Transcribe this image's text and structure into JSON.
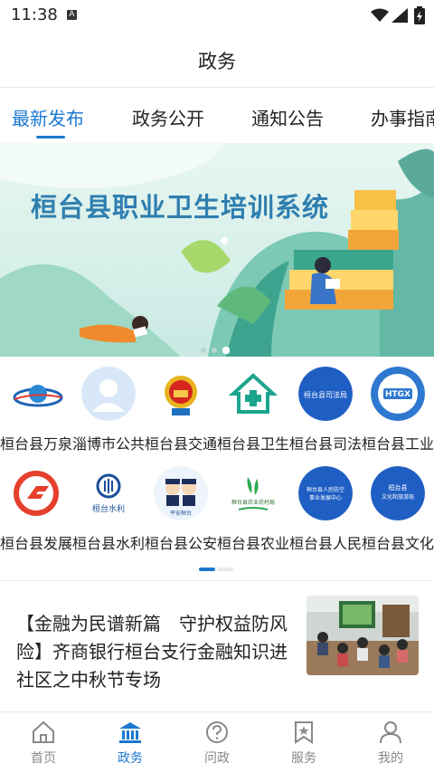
{
  "status_bar": {
    "time": "11:38",
    "a_icon": "A"
  },
  "app_bar": {
    "title": "政务"
  },
  "tabs": [
    {
      "label": "最新发布"
    },
    {
      "label": "政务公开"
    },
    {
      "label": "通知公告"
    },
    {
      "label": "办事指南"
    }
  ],
  "banner": {
    "title": "桓台县职业卫生培训系统",
    "slide_count": 3,
    "active_slide": 2
  },
  "departments_row1": [
    {
      "label": "桓台县万泉",
      "icon": "globe-logo-icon"
    },
    {
      "label": "淄博市公共",
      "icon": "default-avatar-icon"
    },
    {
      "label": "桓台县交通",
      "icon": "national-emblem-icon"
    },
    {
      "label": "桓台县卫生",
      "icon": "health-house-icon"
    },
    {
      "label": "桓台县司法",
      "icon": "judicial-bureau-icon",
      "logo_text": "桓台县司法局"
    },
    {
      "label": "桓台县工业",
      "icon": "htgx-logo-icon",
      "logo_text": "HTGX"
    }
  ],
  "departments_row2": [
    {
      "label": "桓台县发展",
      "icon": "red-f-logo-icon"
    },
    {
      "label": "桓台县水利",
      "icon": "water-conservancy-icon",
      "logo_text": "桓台水利"
    },
    {
      "label": "桓台县公安",
      "icon": "police-cartoon-icon",
      "logo_text": "平安桓台"
    },
    {
      "label": "桓台县农业",
      "icon": "agriculture-logo-icon",
      "logo_text": "桓台县农业农村局"
    },
    {
      "label": "桓台县人民",
      "icon": "air-defense-icon",
      "logo_text": "桓台县人民防空事业发展中心"
    },
    {
      "label": "桓台县文化",
      "icon": "culture-tourism-icon",
      "logo_text": "桓台县文化和旅游局"
    }
  ],
  "news": {
    "title": "【金融为民谱新篇　守护权益防风险】齐商银行桓台支行金融知识进社区之中秋节专场"
  },
  "bottom_nav": [
    {
      "label": "首页",
      "icon": "home-icon",
      "active": false
    },
    {
      "label": "政务",
      "icon": "government-building-icon",
      "active": true
    },
    {
      "label": "问政",
      "icon": "question-circle-icon",
      "active": false
    },
    {
      "label": "服务",
      "icon": "star-bookmark-icon",
      "active": false
    },
    {
      "label": "我的",
      "icon": "person-icon",
      "active": false
    }
  ],
  "colors": {
    "accent": "#1b78d0",
    "text": "#222222",
    "muted": "#888888"
  }
}
